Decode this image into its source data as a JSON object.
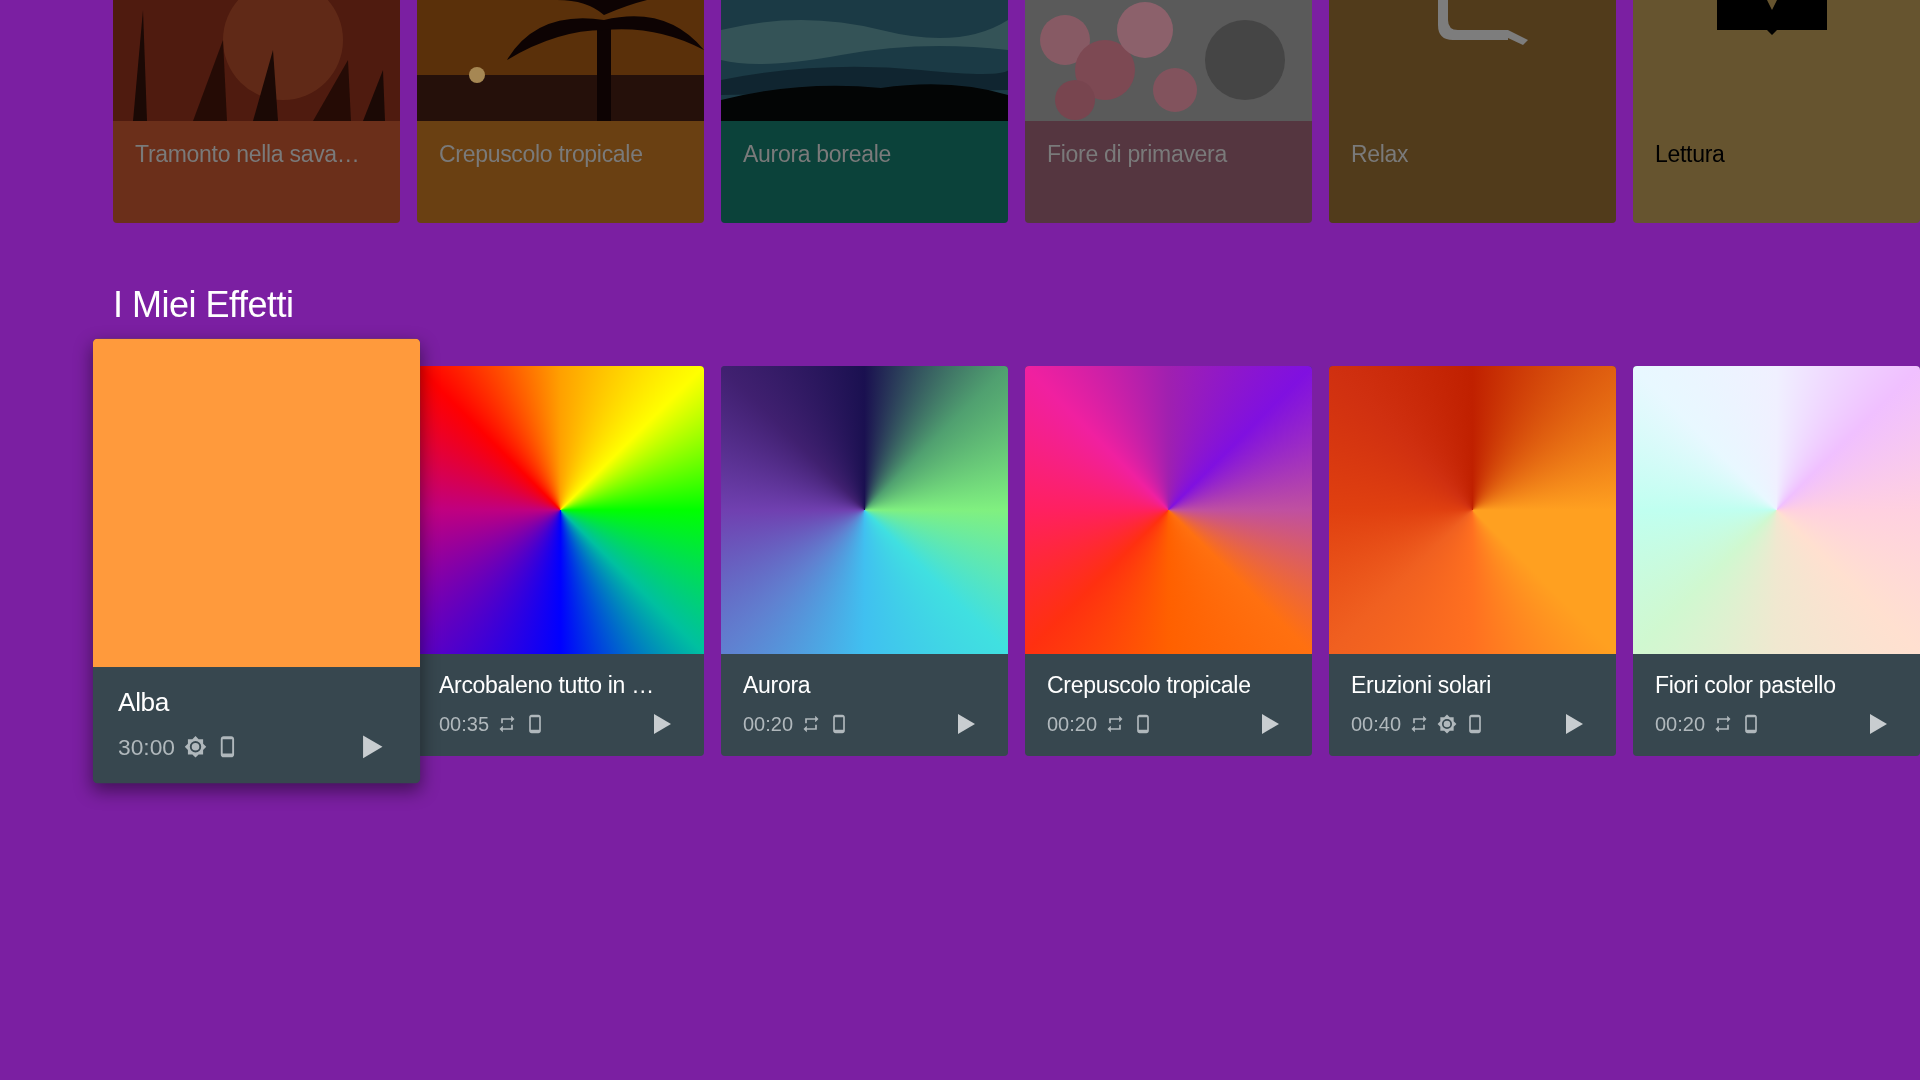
{
  "top_row": [
    {
      "title": "Tramonto nella sava…",
      "color": "#6b2f1a",
      "dimmed": true
    },
    {
      "title": "Crepuscolo tropicale",
      "color": "#6a4012",
      "dimmed": true
    },
    {
      "title": "Aurora boreale",
      "color": "#0b423a",
      "dimmed": true
    },
    {
      "title": "Fiore di primavera",
      "color": "#553640",
      "dimmed": true
    },
    {
      "title": "Relax",
      "kind": "icon",
      "color": "#513b1b",
      "dimmed": true
    },
    {
      "title": "Lettura",
      "kind": "icon",
      "color": "#66542f",
      "dimmed": false
    }
  ],
  "section_title": "I Miei Effetti",
  "effects": [
    {
      "title": "Alba",
      "duration": "30:00",
      "focused": true,
      "repeat": false,
      "brightness": true,
      "device": true,
      "kind": "solid",
      "color": "#ff9a3c"
    },
    {
      "title": "Arcobaleno tutto in …",
      "duration": "00:35",
      "focused": false,
      "repeat": true,
      "brightness": false,
      "device": true,
      "kind": "gradient"
    },
    {
      "title": "Aurora",
      "duration": "00:20",
      "focused": false,
      "repeat": true,
      "brightness": false,
      "device": true,
      "kind": "gradient"
    },
    {
      "title": "Crepuscolo tropicale",
      "duration": "00:20",
      "focused": false,
      "repeat": true,
      "brightness": false,
      "device": true,
      "kind": "gradient"
    },
    {
      "title": "Eruzioni solari",
      "duration": "00:40",
      "focused": false,
      "repeat": true,
      "brightness": true,
      "device": true,
      "kind": "gradient"
    },
    {
      "title": "Fiori color pastello",
      "duration": "00:20",
      "focused": false,
      "repeat": true,
      "brightness": false,
      "device": true,
      "kind": "gradient"
    }
  ]
}
